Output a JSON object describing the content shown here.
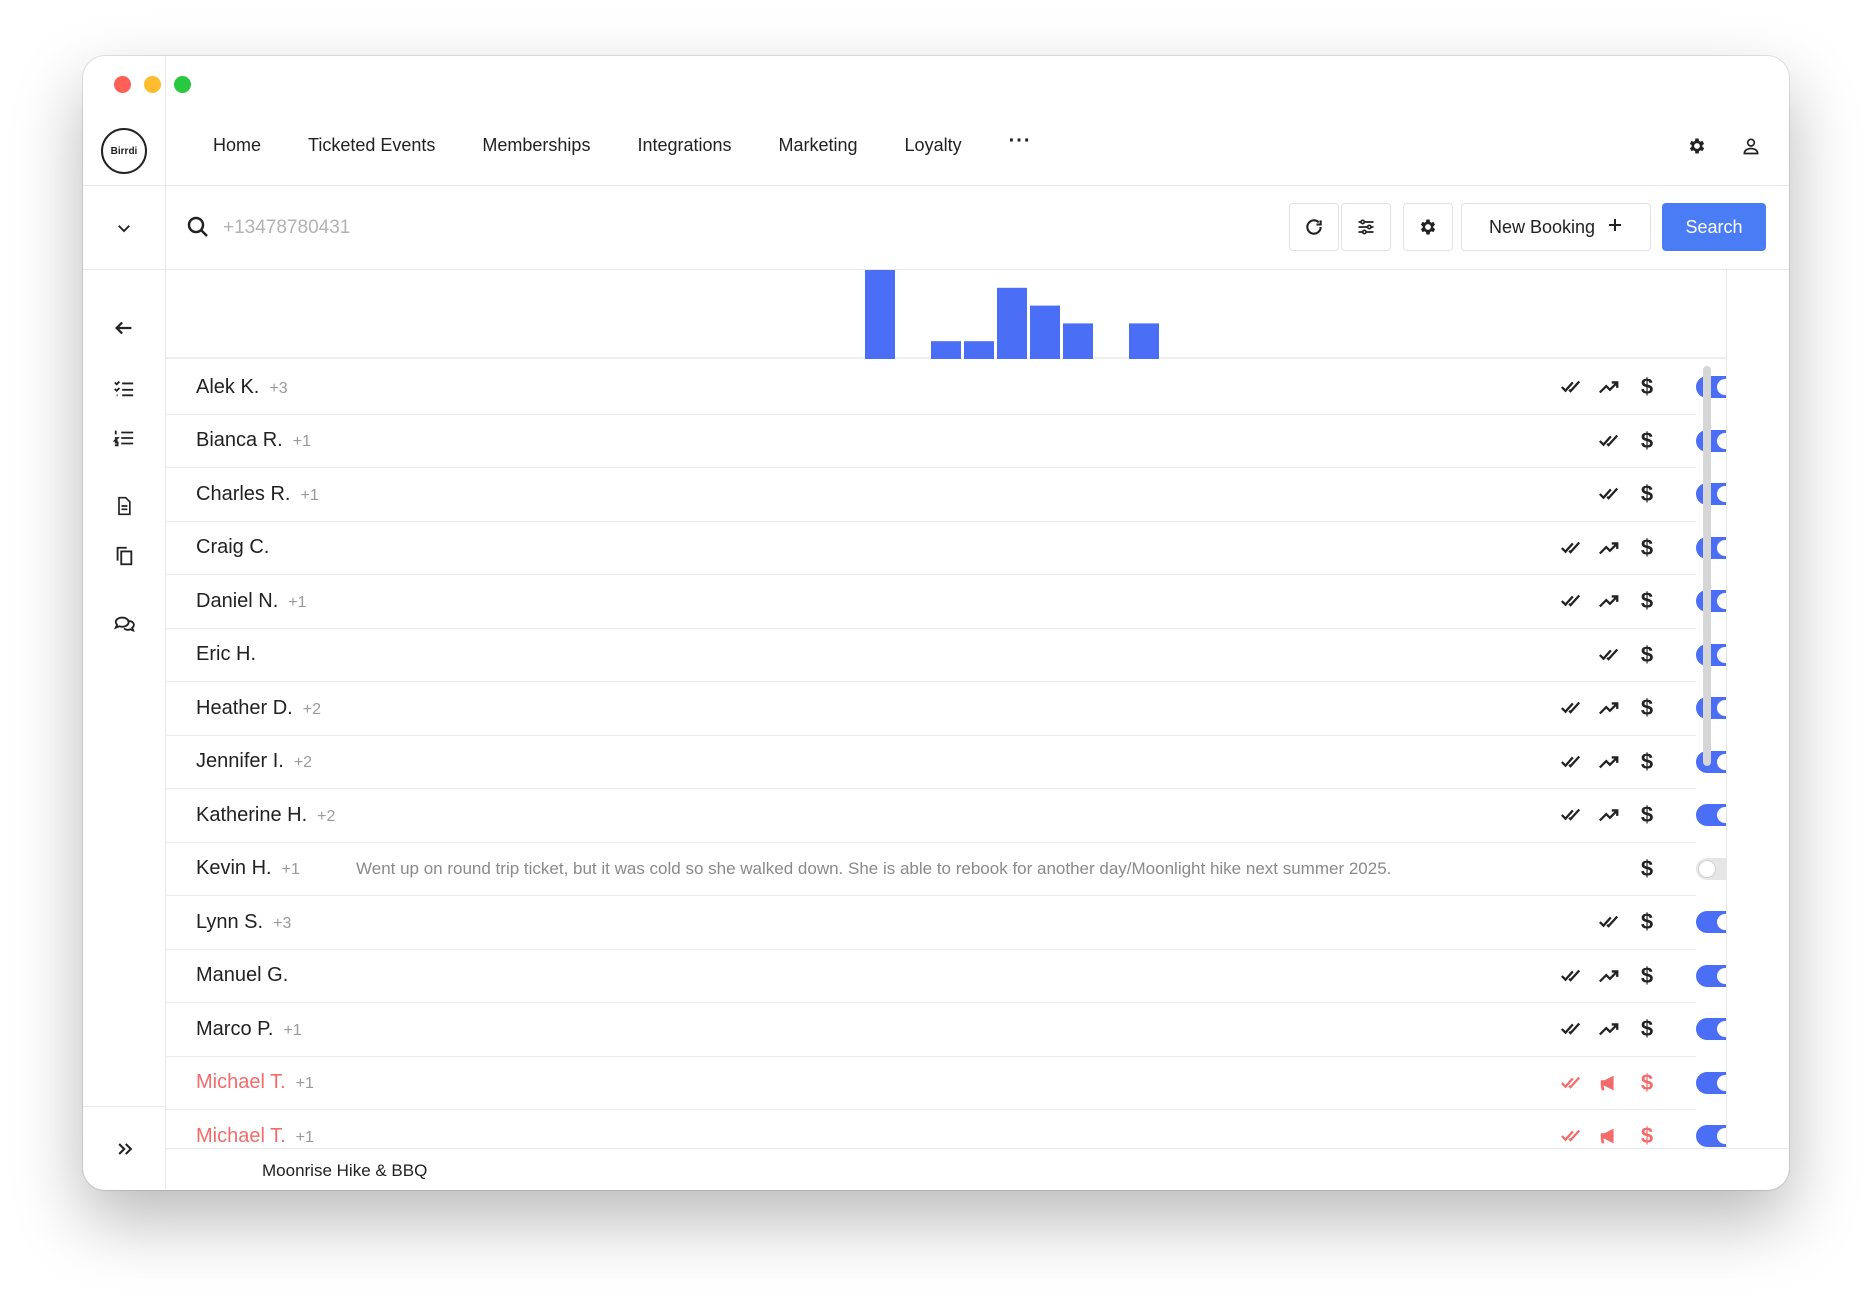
{
  "nav": {
    "logo_text": "Birrdi",
    "links": [
      "Home",
      "Ticketed Events",
      "Memberships",
      "Integrations",
      "Marketing",
      "Loyalty"
    ],
    "more": "···"
  },
  "toolbar": {
    "search_placeholder": "+13478780431",
    "new_booking_label": "New Booking",
    "search_label": "Search"
  },
  "histogram": {
    "type": "bar",
    "values": [
      1.0,
      0,
      0.2,
      0.2,
      0.8,
      0.6,
      0.4,
      0,
      0.4
    ]
  },
  "bookings": [
    {
      "name": "Alek K.",
      "guests": "+3",
      "icons": [
        "check",
        "trend",
        "dollar"
      ],
      "enabled": true,
      "alert": false
    },
    {
      "name": "Bianca R.",
      "guests": "+1",
      "icons": [
        "check",
        "dollar"
      ],
      "enabled": true,
      "alert": false
    },
    {
      "name": "Charles R.",
      "guests": "+1",
      "icons": [
        "check",
        "dollar"
      ],
      "enabled": true,
      "alert": false
    },
    {
      "name": "Craig C.",
      "guests": "",
      "icons": [
        "check",
        "trend",
        "dollar"
      ],
      "enabled": true,
      "alert": false
    },
    {
      "name": "Daniel N.",
      "guests": "+1",
      "icons": [
        "check",
        "trend",
        "dollar"
      ],
      "enabled": true,
      "alert": false
    },
    {
      "name": "Eric H.",
      "guests": "",
      "icons": [
        "check",
        "dollar"
      ],
      "enabled": true,
      "alert": false
    },
    {
      "name": "Heather D.",
      "guests": "+2",
      "icons": [
        "check",
        "trend",
        "dollar"
      ],
      "enabled": true,
      "alert": false
    },
    {
      "name": "Jennifer I.",
      "guests": "+2",
      "icons": [
        "check",
        "trend",
        "dollar"
      ],
      "enabled": true,
      "alert": false
    },
    {
      "name": "Katherine H.",
      "guests": "+2",
      "icons": [
        "check",
        "trend",
        "dollar"
      ],
      "enabled": true,
      "alert": false
    },
    {
      "name": "Kevin H.",
      "guests": "+1",
      "note": "Went up on round trip ticket, but it was cold so she walked down. She is able to rebook for another day/Moonlight hike next summer 2025.",
      "icons": [
        "dollar"
      ],
      "enabled": false,
      "alert": false
    },
    {
      "name": "Lynn S.",
      "guests": "+3",
      "icons": [
        "check",
        "dollar"
      ],
      "enabled": true,
      "alert": false
    },
    {
      "name": "Manuel G.",
      "guests": "",
      "icons": [
        "check",
        "trend",
        "dollar"
      ],
      "enabled": true,
      "alert": false
    },
    {
      "name": "Marco P.",
      "guests": "+1",
      "icons": [
        "check",
        "trend",
        "dollar"
      ],
      "enabled": true,
      "alert": false
    },
    {
      "name": "Michael T.",
      "guests": "+1",
      "icons": [
        "check",
        "megaphone",
        "dollar"
      ],
      "enabled": true,
      "alert": true
    },
    {
      "name": "Michael T.",
      "guests": "+1",
      "icons": [
        "check",
        "megaphone",
        "dollar"
      ],
      "enabled": true,
      "alert": true
    }
  ],
  "footer": {
    "event_title": "Moonrise Hike & BBQ"
  },
  "colors": {
    "accent": "#4a6ef5",
    "button_primary": "#4a7cf6",
    "alert": "#f36b6b"
  }
}
